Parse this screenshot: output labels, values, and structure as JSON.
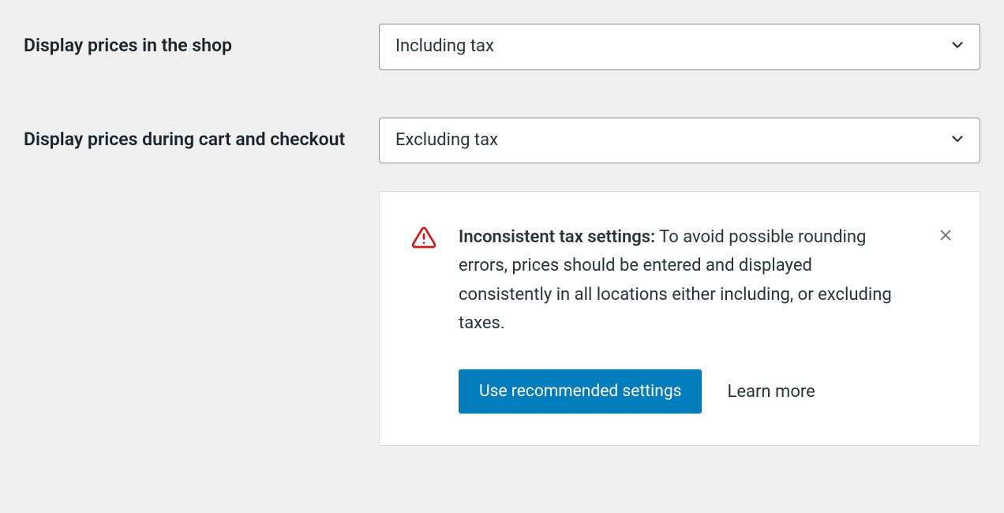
{
  "settings": {
    "display_shop": {
      "label": "Display prices in the shop",
      "value": "Including tax"
    },
    "display_cart": {
      "label": "Display prices during cart and checkout",
      "value": "Excluding tax"
    }
  },
  "notice": {
    "title": "Inconsistent tax settings:",
    "body": "To avoid possible rounding errors, prices should be entered and displayed consistently in all locations either including, or excluding taxes.",
    "primary_button": "Use recommended settings",
    "link": "Learn more"
  }
}
